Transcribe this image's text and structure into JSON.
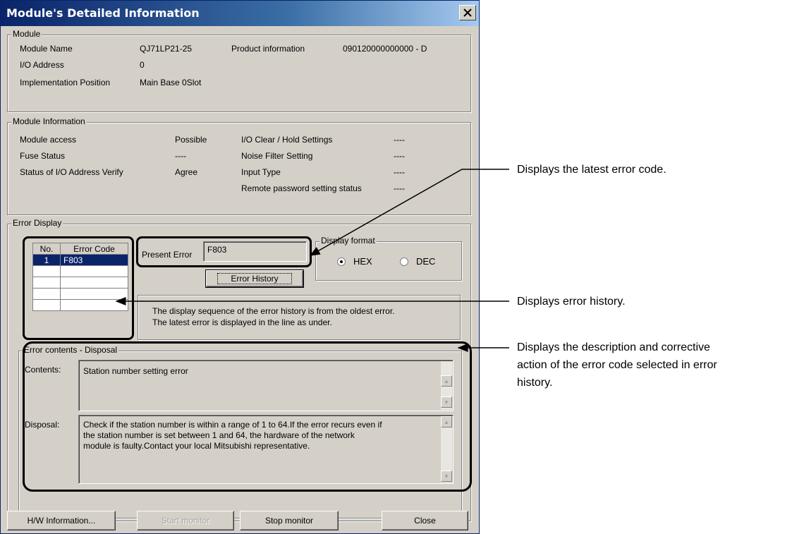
{
  "window": {
    "title": "Module's Detailed Information"
  },
  "module": {
    "group_label": "Module",
    "name_label": "Module Name",
    "name_value": "QJ71LP21-25",
    "product_label": "Product information",
    "product_value": "090120000000000 - D",
    "io_label": "I/O Address",
    "io_value": "0",
    "impl_label": "Implementation Position",
    "impl_value": "Main Base  0Slot"
  },
  "module_info": {
    "group_label": "Module Information",
    "access_label": "Module access",
    "access_value": "Possible",
    "fuse_label": "Fuse Status",
    "fuse_value": "----",
    "verify_label": "Status of I/O Address Verify",
    "verify_value": "Agree",
    "clear_label": "I/O Clear / Hold Settings",
    "clear_value": "----",
    "noise_label": "Noise Filter Setting",
    "noise_value": "----",
    "input_label": "Input Type",
    "input_value": "----",
    "remote_label": "Remote password setting status",
    "remote_value": "----"
  },
  "error_display": {
    "group_label": "Error Display",
    "col_no": "No.",
    "col_code": "Error Code",
    "rows": [
      {
        "no": "1",
        "code": "F803"
      }
    ],
    "present_label": "Present Error",
    "present_value": "F803",
    "history_button": "Error History",
    "format_label": "Display format",
    "hex_label": "HEX",
    "dec_label": "DEC",
    "selected_format": "HEX",
    "note_line1": "The display sequence of the error history is from the oldest error.",
    "note_line2": "The latest error is displayed in the line as under."
  },
  "error_contents": {
    "group_label": "Error contents - Disposal",
    "contents_label": "Contents:",
    "contents_value": "Station number setting error",
    "disposal_label": "Disposal:",
    "disposal_line1": "Check if the station number is within a range of 1 to 64.If the error recurs even if",
    "disposal_line2": "the station number is set between 1 and 64, the hardware of the network",
    "disposal_line3": "module is faulty.Contact your local Mitsubishi representative."
  },
  "buttons": {
    "hw_info": "H/W Information...",
    "start_monitor": "Start monitor",
    "stop_monitor": "Stop monitor",
    "close": "Close"
  },
  "annotations": {
    "latest": "Displays the latest error code.",
    "history": "Displays error history.",
    "desc_line1": "Displays the description and corrective",
    "desc_line2": "action of the error code selected in error",
    "desc_line3": "history."
  }
}
